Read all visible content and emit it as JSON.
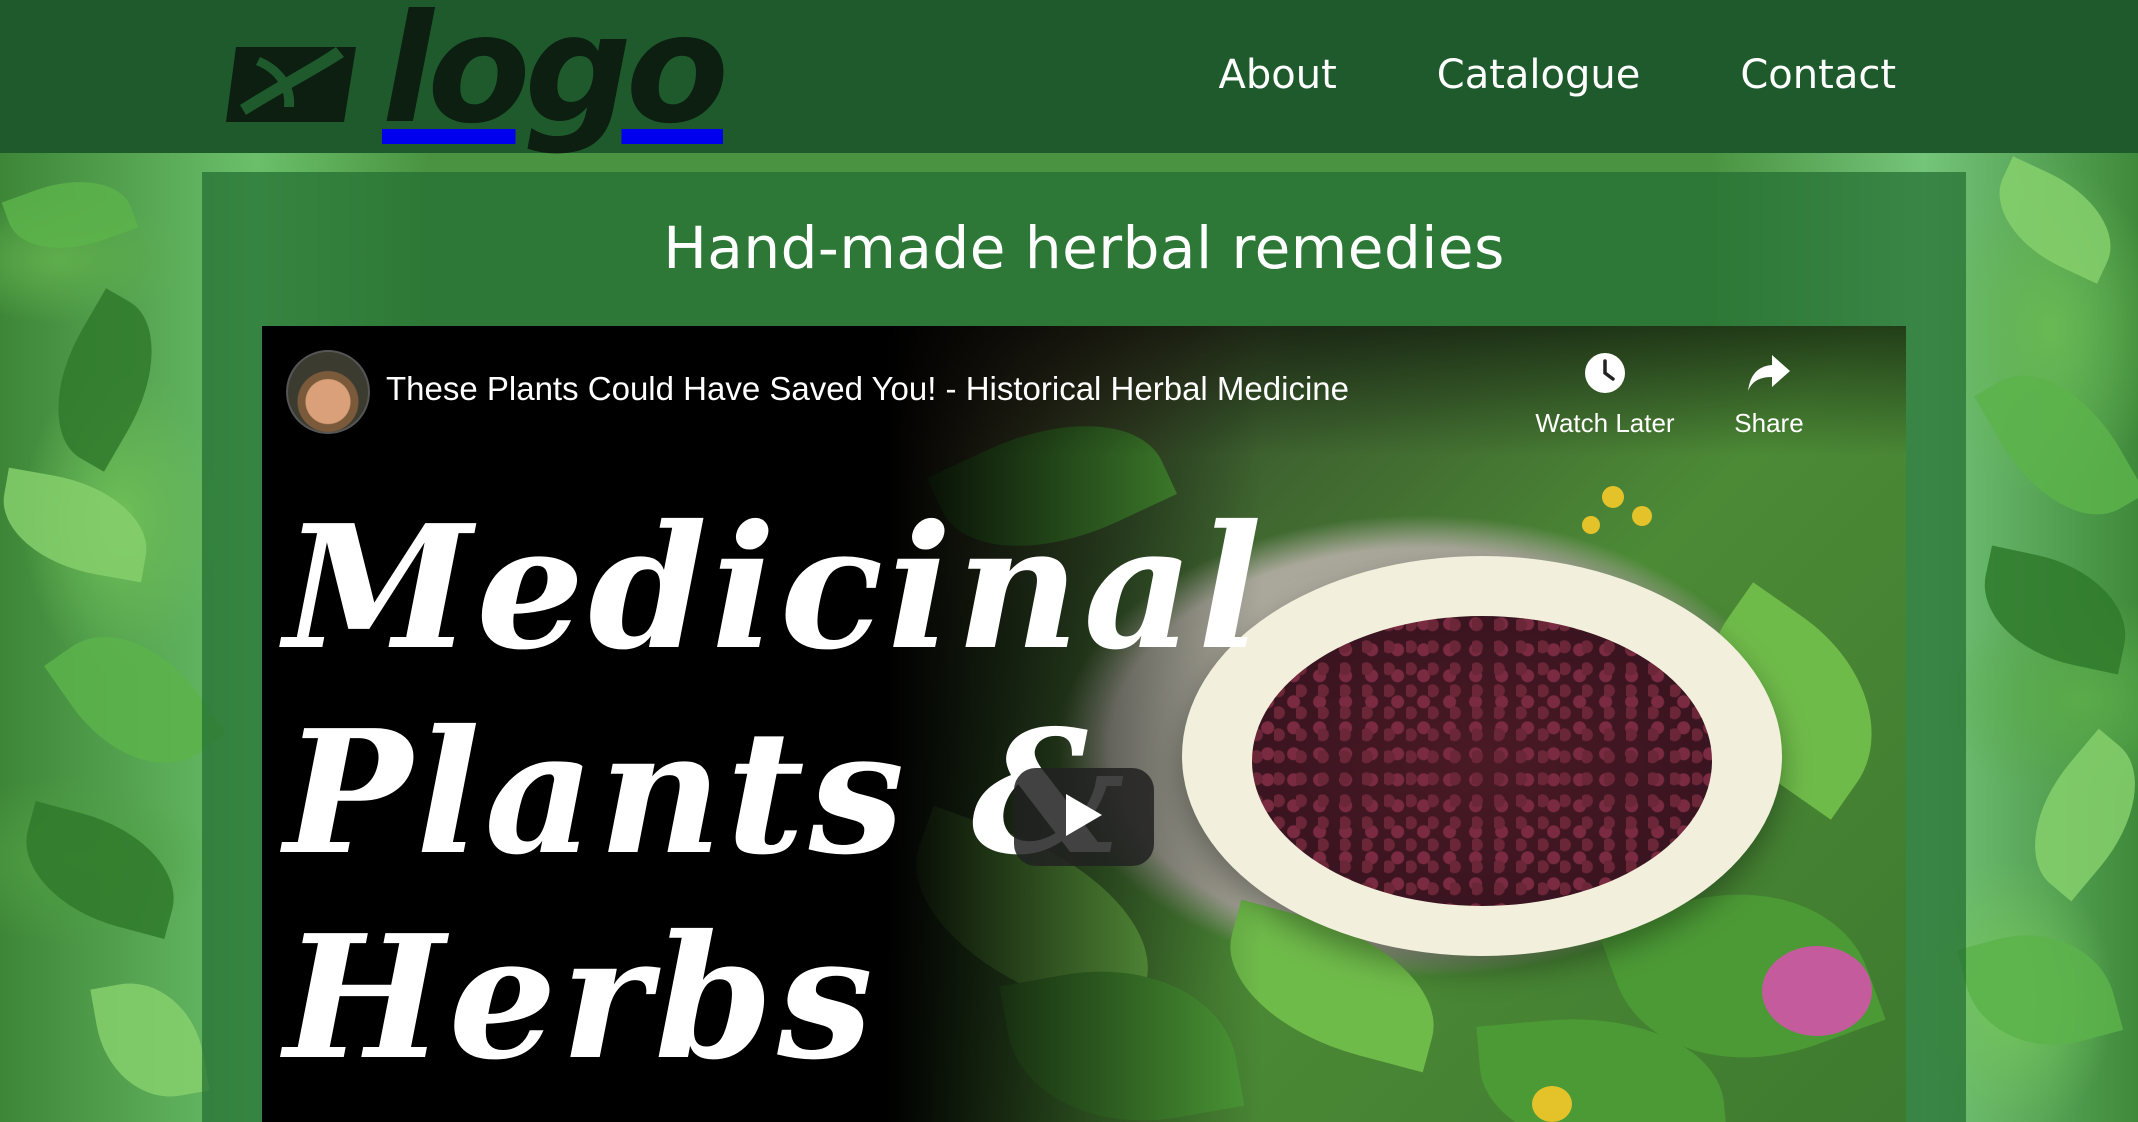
{
  "header": {
    "logo_text": "logo",
    "nav": [
      {
        "label": "About"
      },
      {
        "label": "Catalogue"
      },
      {
        "label": "Contact"
      }
    ]
  },
  "main": {
    "heading": "Hand-made herbal remedies"
  },
  "video": {
    "title": "These Plants Could Have Saved You! - Historical Herbal Medicine",
    "watch_later_label": "Watch Later",
    "share_label": "Share",
    "thumbnail_text": [
      "Medicinal",
      "Plants &",
      "Herbs"
    ]
  },
  "colors": {
    "header_bg": "#1e5a2c",
    "content_bg": "#226e32",
    "text": "#ffffff"
  }
}
